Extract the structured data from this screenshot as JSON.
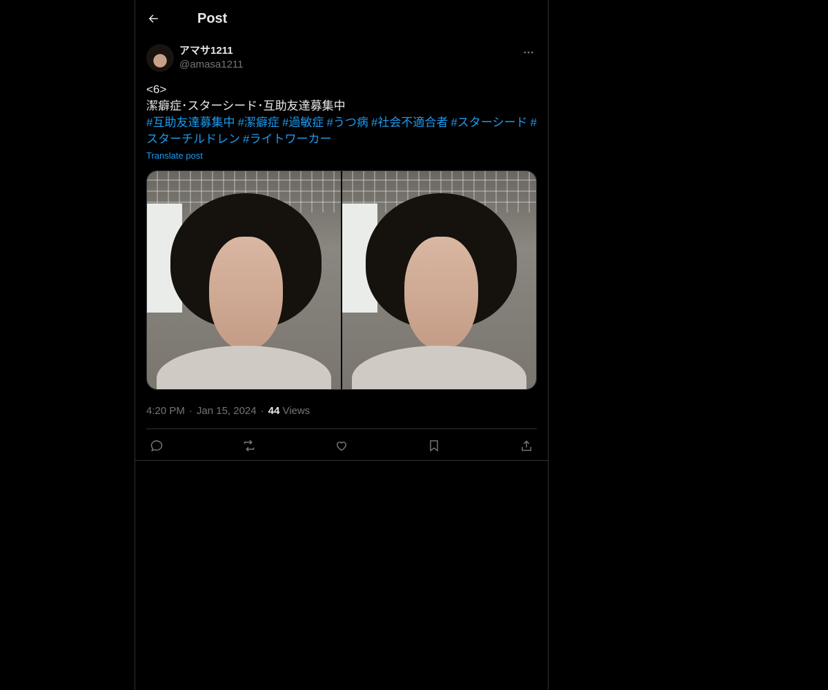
{
  "header": {
    "title": "Post",
    "back_icon": "arrow-left-icon"
  },
  "author": {
    "display_name": "アマサ1211",
    "handle": "@amasa1211",
    "more_icon": "more-horizontal-icon"
  },
  "post": {
    "line1": "<6>",
    "line2": "潔癖症･スターシード･互助友達募集中",
    "hashtags": [
      "#互助友達募集中",
      "#潔癖症",
      "#過敏症",
      "#うつ病",
      "#社会不適合者",
      "#スターシード",
      "#スターチルドレン",
      "#ライトワーカー"
    ],
    "translate_label": "Translate post"
  },
  "media": {
    "count": 2
  },
  "meta": {
    "time": "4:20 PM",
    "date": "Jan 15, 2024",
    "views_count": "44",
    "views_label": "Views",
    "sep": "·"
  },
  "actions": [
    "reply-icon",
    "repost-icon",
    "like-icon",
    "bookmark-icon",
    "share-icon"
  ],
  "colors": {
    "background": "#000000",
    "text": "#e7e9ea",
    "secondary": "#71767b",
    "accent": "#1d9bf0",
    "border": "#2f3336"
  }
}
